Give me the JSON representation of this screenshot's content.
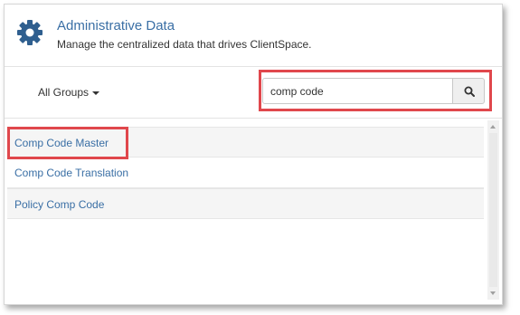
{
  "header": {
    "title": "Administrative Data",
    "subtitle": "Manage the centralized data that drives ClientSpace.",
    "icon": "gear-icon"
  },
  "toolbar": {
    "group_filter_label": "All Groups",
    "search": {
      "value": "comp code",
      "placeholder": "",
      "button_icon": "search-icon"
    }
  },
  "results": [
    {
      "label": "Comp Code Master"
    },
    {
      "label": "Comp Code Translation"
    },
    {
      "label": "Policy Comp Code"
    }
  ],
  "colors": {
    "link": "#3a6fa5",
    "highlight": "#e0474c"
  }
}
